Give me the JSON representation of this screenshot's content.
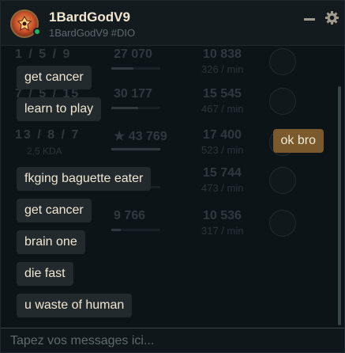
{
  "header": {
    "username": "1BardGodV9",
    "tag": "1BardGodV9 #DIO",
    "status": "online",
    "status_color": "#1cb864",
    "avatar_icon": "bard-profile-icon",
    "minimize_icon": "minimize-icon",
    "settings_icon": "gear-icon"
  },
  "background_stats": [
    {
      "kda": "1 / 5 / 9",
      "kda_sub": "",
      "score": "27 070",
      "bar": 0.45,
      "gold": "10 838",
      "gpm": "326 / min"
    },
    {
      "kda": "7 / 5 / 15",
      "kda_sub": "",
      "score": "30 177",
      "bar": 0.55,
      "gold": "15 545",
      "gpm": "467 / min"
    },
    {
      "kda": "13 / 8 / 7",
      "kda_sub": "2,5 KDA",
      "score": "★ 43 769",
      "bar": 1.0,
      "gold": "17 400",
      "gpm": "523 / min"
    },
    {
      "kda": "",
      "kda_sub": "",
      "score": "",
      "bar": 0.0,
      "gold": "15 744",
      "gpm": "473 / min"
    },
    {
      "kda": "",
      "kda_sub": "",
      "score": "9 766",
      "bar": 0.2,
      "gold": "10 536",
      "gpm": "317 / min"
    }
  ],
  "messages": [
    {
      "text": "get cancer",
      "direction": "in"
    },
    {
      "text": "learn to play",
      "direction": "in"
    },
    {
      "text": "ok bro",
      "direction": "out"
    },
    {
      "text": "fkging baguette eater",
      "direction": "in"
    },
    {
      "text": "get cancer",
      "direction": "in"
    },
    {
      "text": "brain one",
      "direction": "in"
    },
    {
      "text": "die fast",
      "direction": "in"
    },
    {
      "text": "u waste of human",
      "direction": "in"
    }
  ],
  "composer": {
    "placeholder": "Tapez vos messages ici...",
    "value": ""
  },
  "colors": {
    "incoming_bubble": "#222a2d",
    "outgoing_bubble": "#7a5a2c",
    "text_primary": "#f0e6d2"
  }
}
